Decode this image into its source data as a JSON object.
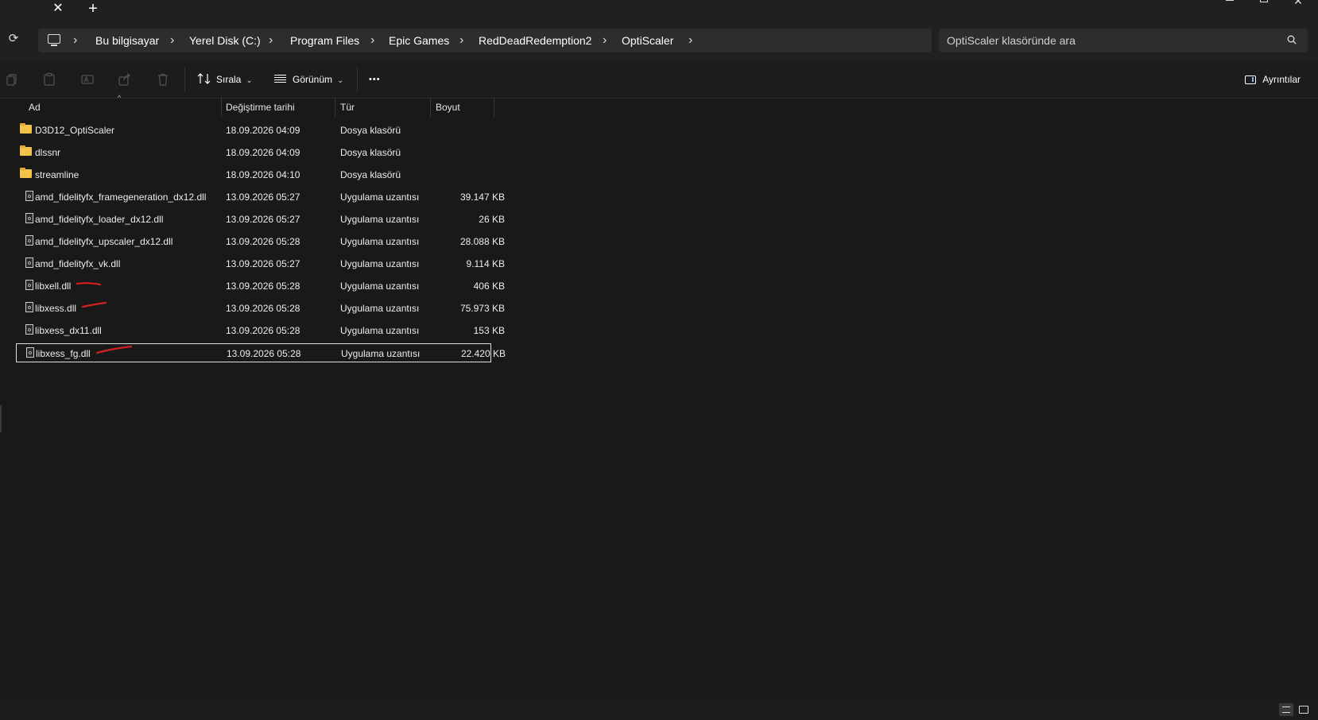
{
  "window": {
    "tab_close_glyph": "✕",
    "new_tab_glyph": "+",
    "close_glyph": "✕"
  },
  "address": {
    "refresh_glyph": "⟳",
    "separator_glyph": "›",
    "crumbs": [
      "Bu bilgisayar",
      "Yerel Disk (C:)",
      "Program Files",
      "Epic Games",
      "RedDeadRedemption2",
      "OptiScaler"
    ]
  },
  "search": {
    "placeholder": "OptiScaler klasöründe ara"
  },
  "toolbar": {
    "sort_label": "Sırala",
    "view_label": "Görünüm",
    "more_label": "•••",
    "details_label": "Ayrıntılar",
    "chevron_glyph": "⌄"
  },
  "columns": {
    "name": "Ad",
    "date": "Değiştirme tarihi",
    "type": "Tür",
    "size": "Boyut",
    "sort_glyph": "^"
  },
  "files": [
    {
      "name": "D3D12_OptiScaler",
      "date": "18.09.2026 04:09",
      "type": "Dosya klasörü",
      "size": "",
      "icon": "folder-icon"
    },
    {
      "name": "dlssnr",
      "date": "18.09.2026 04:09",
      "type": "Dosya klasörü",
      "size": "",
      "icon": "folder-icon"
    },
    {
      "name": "streamline",
      "date": "18.09.2026 04:10",
      "type": "Dosya klasörü",
      "size": "",
      "icon": "folder-icon"
    },
    {
      "name": "amd_fidelityfx_framegeneration_dx12.dll",
      "date": "13.09.2026 05:27",
      "type": "Uygulama uzantısı",
      "size": "39.147 KB",
      "icon": "dll-file-icon"
    },
    {
      "name": "amd_fidelityfx_loader_dx12.dll",
      "date": "13.09.2026 05:27",
      "type": "Uygulama uzantısı",
      "size": "26 KB",
      "icon": "dll-file-icon"
    },
    {
      "name": "amd_fidelityfx_upscaler_dx12.dll",
      "date": "13.09.2026 05:28",
      "type": "Uygulama uzantısı",
      "size": "28.088 KB",
      "icon": "dll-file-icon"
    },
    {
      "name": "amd_fidelityfx_vk.dll",
      "date": "13.09.2026 05:27",
      "type": "Uygulama uzantısı",
      "size": "9.114 KB",
      "icon": "dll-file-icon"
    },
    {
      "name": "libxell.dll",
      "date": "13.09.2026 05:28",
      "type": "Uygulama uzantısı",
      "size": "406 KB",
      "icon": "dll-file-icon",
      "marked": true
    },
    {
      "name": "libxess.dll",
      "date": "13.09.2026 05:28",
      "type": "Uygulama uzantısı",
      "size": "75.973 KB",
      "icon": "dll-file-icon",
      "marked": true
    },
    {
      "name": "libxess_dx11.dll",
      "date": "13.09.2026 05:28",
      "type": "Uygulama uzantısı",
      "size": "153 KB",
      "icon": "dll-file-icon"
    },
    {
      "name": "libxess_fg.dll",
      "date": "13.09.2026 05:28",
      "type": "Uygulama uzantısı",
      "size": "22.420 KB",
      "icon": "dll-file-icon",
      "selected": true,
      "marked": true
    }
  ],
  "colors": {
    "background": "#191919",
    "annotation_red": "#d42020",
    "folder_yellow": "#f3c44c"
  }
}
